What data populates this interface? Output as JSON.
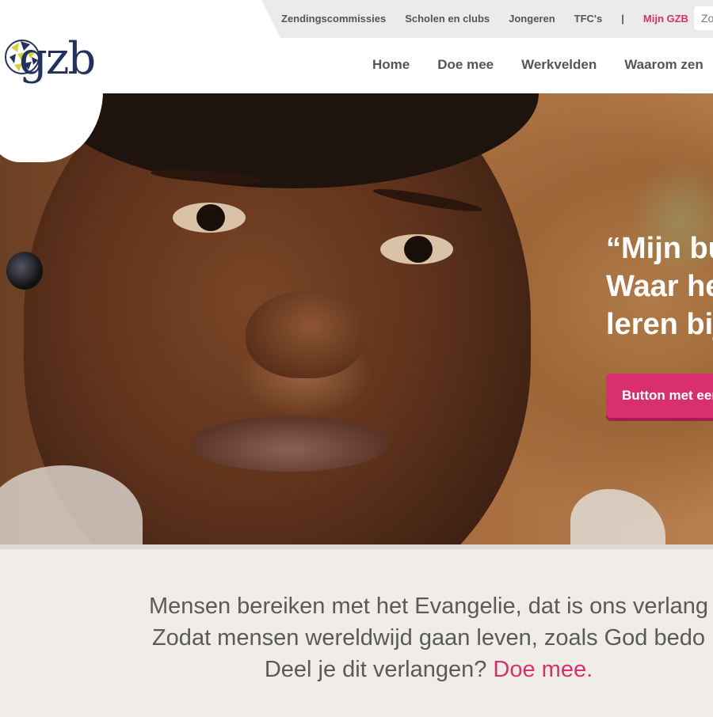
{
  "topbar": {
    "links": [
      "Zendingscommissies",
      "Scholen en clubs",
      "Jongeren",
      "TFC's"
    ],
    "separator": "|",
    "account_link": "Mijn GZB",
    "search_placeholder": "Zo"
  },
  "logo": {
    "text": "gzb"
  },
  "mainnav": {
    "items": [
      "Home",
      "Doe mee",
      "Werkvelden",
      "Waarom zen"
    ]
  },
  "hero": {
    "quote_lines": [
      "“Mijn bu",
      "Waar he",
      "leren bij"
    ],
    "button_label": "Button met een"
  },
  "intro": {
    "line1": "Mensen bereiken met het Evangelie, dat is ons verlang",
    "line2": "Zodat mensen wereldwijd gaan leven, zoals God bedo",
    "line3_text": "Deel je dit verlangen? ",
    "line3_link": "Doe mee."
  },
  "colors": {
    "accent": "#d92f6e",
    "logo": "#23325c",
    "text": "#5a5a5a"
  }
}
